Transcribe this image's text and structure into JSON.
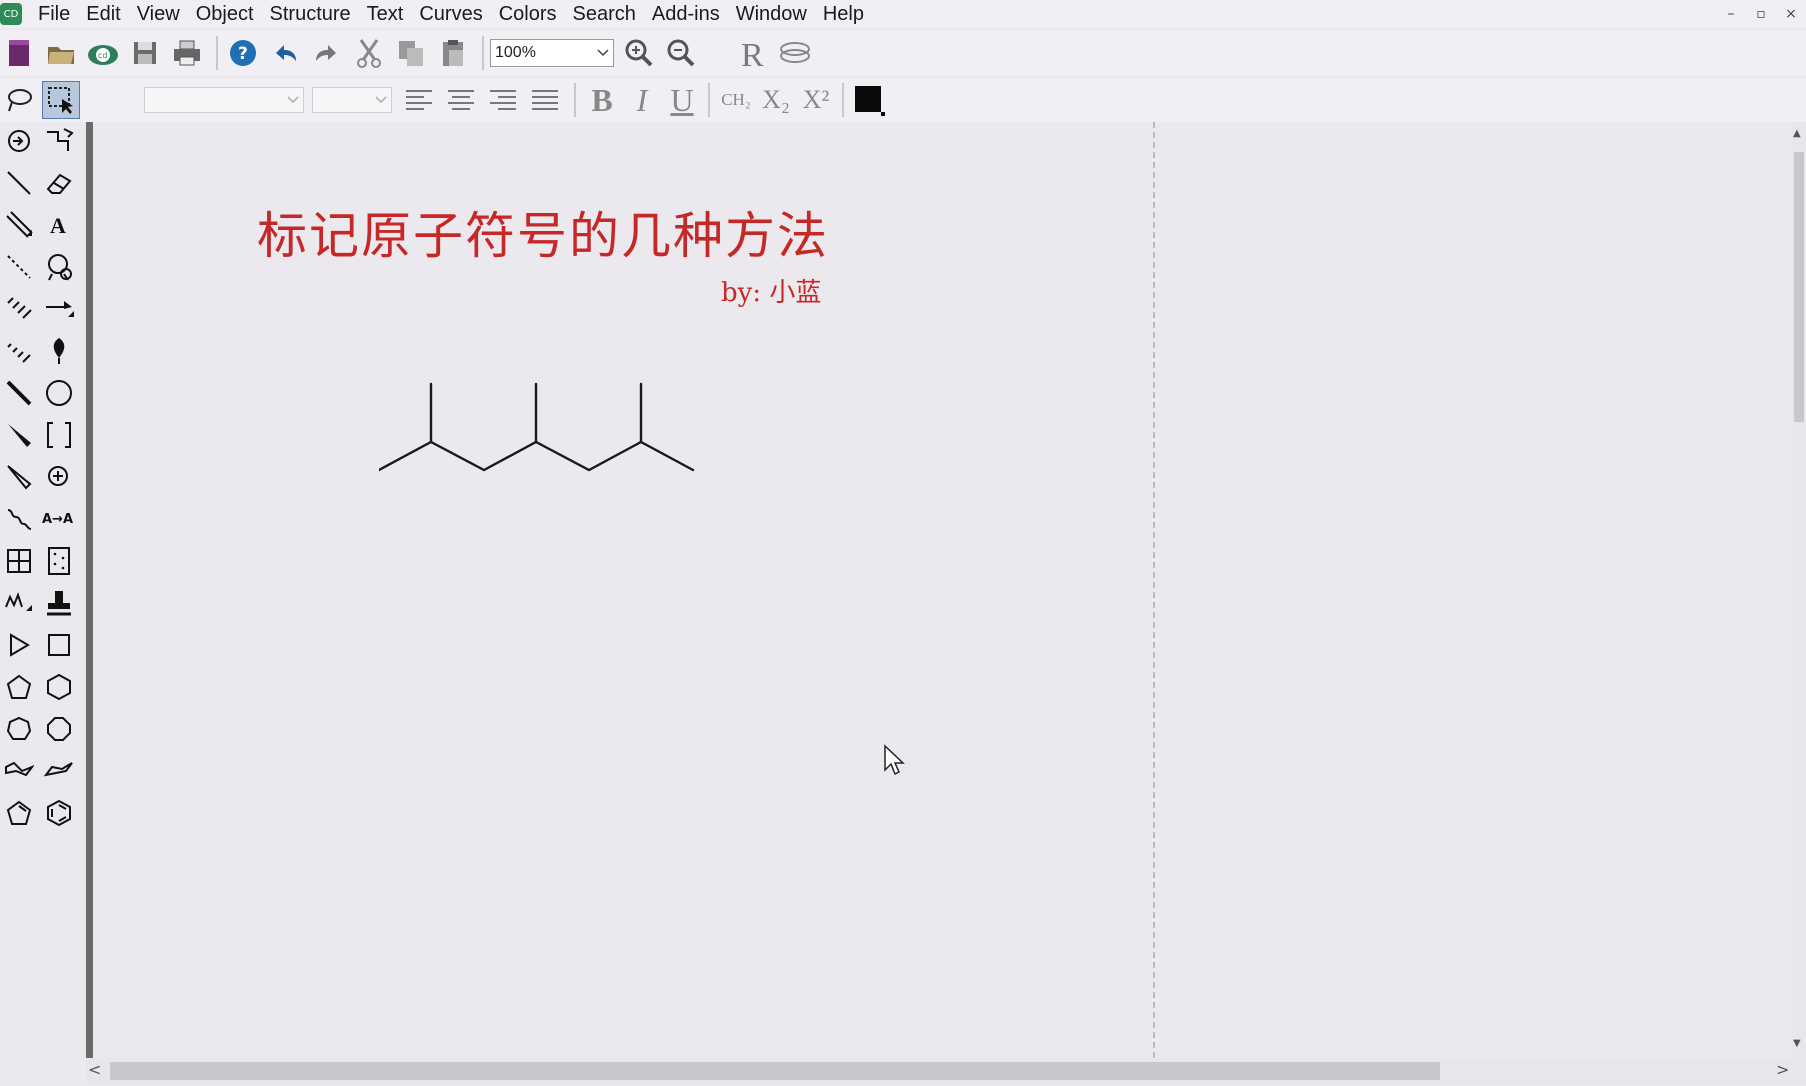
{
  "app": {
    "icon_label": "CD"
  },
  "menu": {
    "items": [
      "File",
      "Edit",
      "View",
      "Object",
      "Structure",
      "Text",
      "Curves",
      "Colors",
      "Search",
      "Add-ins",
      "Window",
      "Help"
    ]
  },
  "window_controls": {
    "minimize": "–",
    "restore": "▫",
    "close": "×"
  },
  "toolbar": {
    "zoom_value": "100%"
  },
  "format": {
    "bold": "B",
    "italic": "I",
    "underline": "U",
    "ch2": "CH₂",
    "subscript": "X₂",
    "superscript": "X²"
  },
  "document": {
    "title": "标记原子符号的几种方法",
    "author": "by:  小蓝"
  },
  "scroll": {
    "left": "<",
    "right": ">",
    "up": "▲",
    "down": "▼"
  }
}
